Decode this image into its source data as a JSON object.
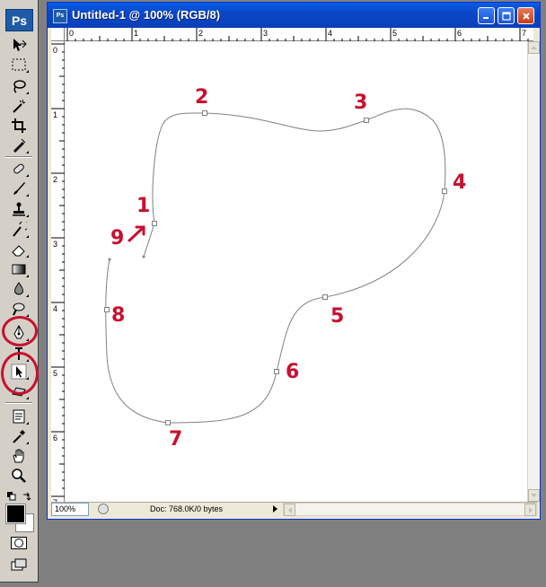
{
  "toolbox": {
    "logo": "Ps",
    "tools": [
      {
        "name": "move-tool-icon"
      },
      {
        "name": "marquee-tool-icon"
      },
      {
        "name": "lasso-tool-icon"
      },
      {
        "name": "magic-wand-tool-icon"
      },
      {
        "name": "crop-tool-icon"
      },
      {
        "name": "slice-tool-icon"
      },
      {
        "name": "healing-brush-tool-icon"
      },
      {
        "name": "brush-tool-icon"
      },
      {
        "name": "clone-stamp-tool-icon"
      },
      {
        "name": "history-brush-tool-icon"
      },
      {
        "name": "eraser-tool-icon"
      },
      {
        "name": "gradient-tool-icon"
      },
      {
        "name": "blur-tool-icon"
      },
      {
        "name": "dodge-tool-icon"
      },
      {
        "name": "pen-tool-icon"
      },
      {
        "name": "type-tool-icon"
      },
      {
        "name": "path-selection-tool-icon"
      },
      {
        "name": "shape-tool-icon"
      },
      {
        "name": "notes-tool-icon"
      },
      {
        "name": "eyedropper-tool-icon"
      },
      {
        "name": "hand-tool-icon"
      },
      {
        "name": "zoom-tool-icon"
      }
    ],
    "foreground_color": "#000000",
    "background_color": "#ffffff"
  },
  "window": {
    "title": "Untitled-1 @ 100% (RGB/8)",
    "icon_label": "Ps"
  },
  "rulers": {
    "horizontal": [
      "0",
      "1",
      "2",
      "3",
      "4",
      "5",
      "6",
      "7"
    ],
    "vertical": [
      "0",
      "1",
      "2",
      "3",
      "4",
      "5",
      "6",
      "7"
    ]
  },
  "annotations": [
    "1",
    "2",
    "3",
    "4",
    "5",
    "6",
    "7",
    "8",
    "9"
  ],
  "annotation_color": "#c8102e",
  "status": {
    "zoom": "100%",
    "doc_info": "Doc: 768.0K/0 bytes"
  }
}
